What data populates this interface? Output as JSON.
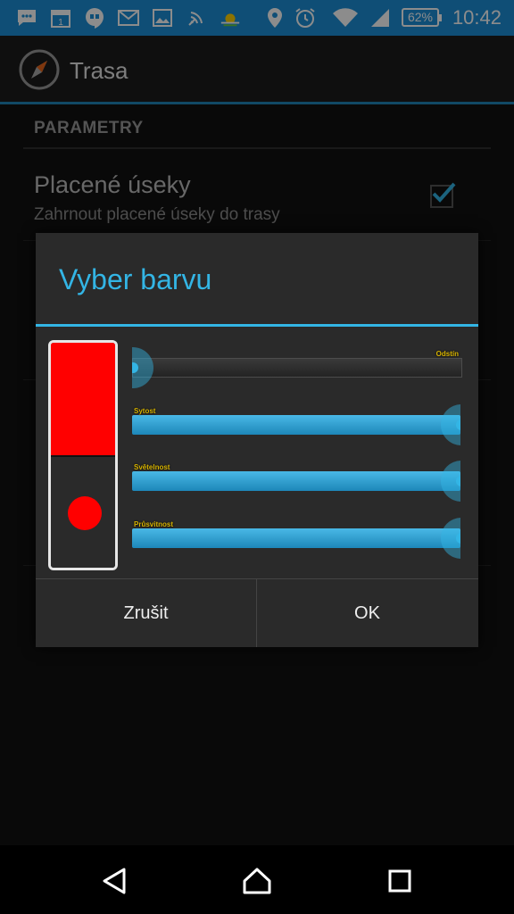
{
  "status_bar": {
    "time": "10:42",
    "battery": "62%",
    "icons": [
      "chat-icon",
      "calendar-icon",
      "hangouts-icon",
      "gmail-icon",
      "gallery-icon",
      "signal-broadcast-icon",
      "weather-icon",
      "location-icon",
      "alarm-icon",
      "wifi-icon",
      "cell-signal-icon",
      "battery-icon"
    ],
    "calendar_day": "1"
  },
  "app": {
    "title": "Trasa",
    "icon": "compass-icon"
  },
  "preferences": {
    "section_header": "PARAMETRY",
    "items": [
      {
        "title": "Placené úseky",
        "summary": "Zahrnout placené úseky do trasy",
        "checked": true
      }
    ]
  },
  "dialog": {
    "title": "Vyber barvu",
    "selected_color": "#ff0000",
    "sliders": [
      {
        "label": "Odstín",
        "value": 0.0
      },
      {
        "label": "Sytost",
        "value": 1.0
      },
      {
        "label": "Světelnost",
        "value": 1.0
      },
      {
        "label": "Průsvitnost",
        "value": 1.0
      }
    ],
    "buttons": {
      "cancel": "Zrušit",
      "ok": "OK"
    }
  },
  "colors": {
    "status_bar": "#1c8fd8",
    "accent": "#33b5e5",
    "background": "#111111",
    "dialog": "#2a2a2a"
  },
  "nav_bar": {
    "icons": [
      "back-icon",
      "home-icon",
      "recents-icon"
    ]
  }
}
